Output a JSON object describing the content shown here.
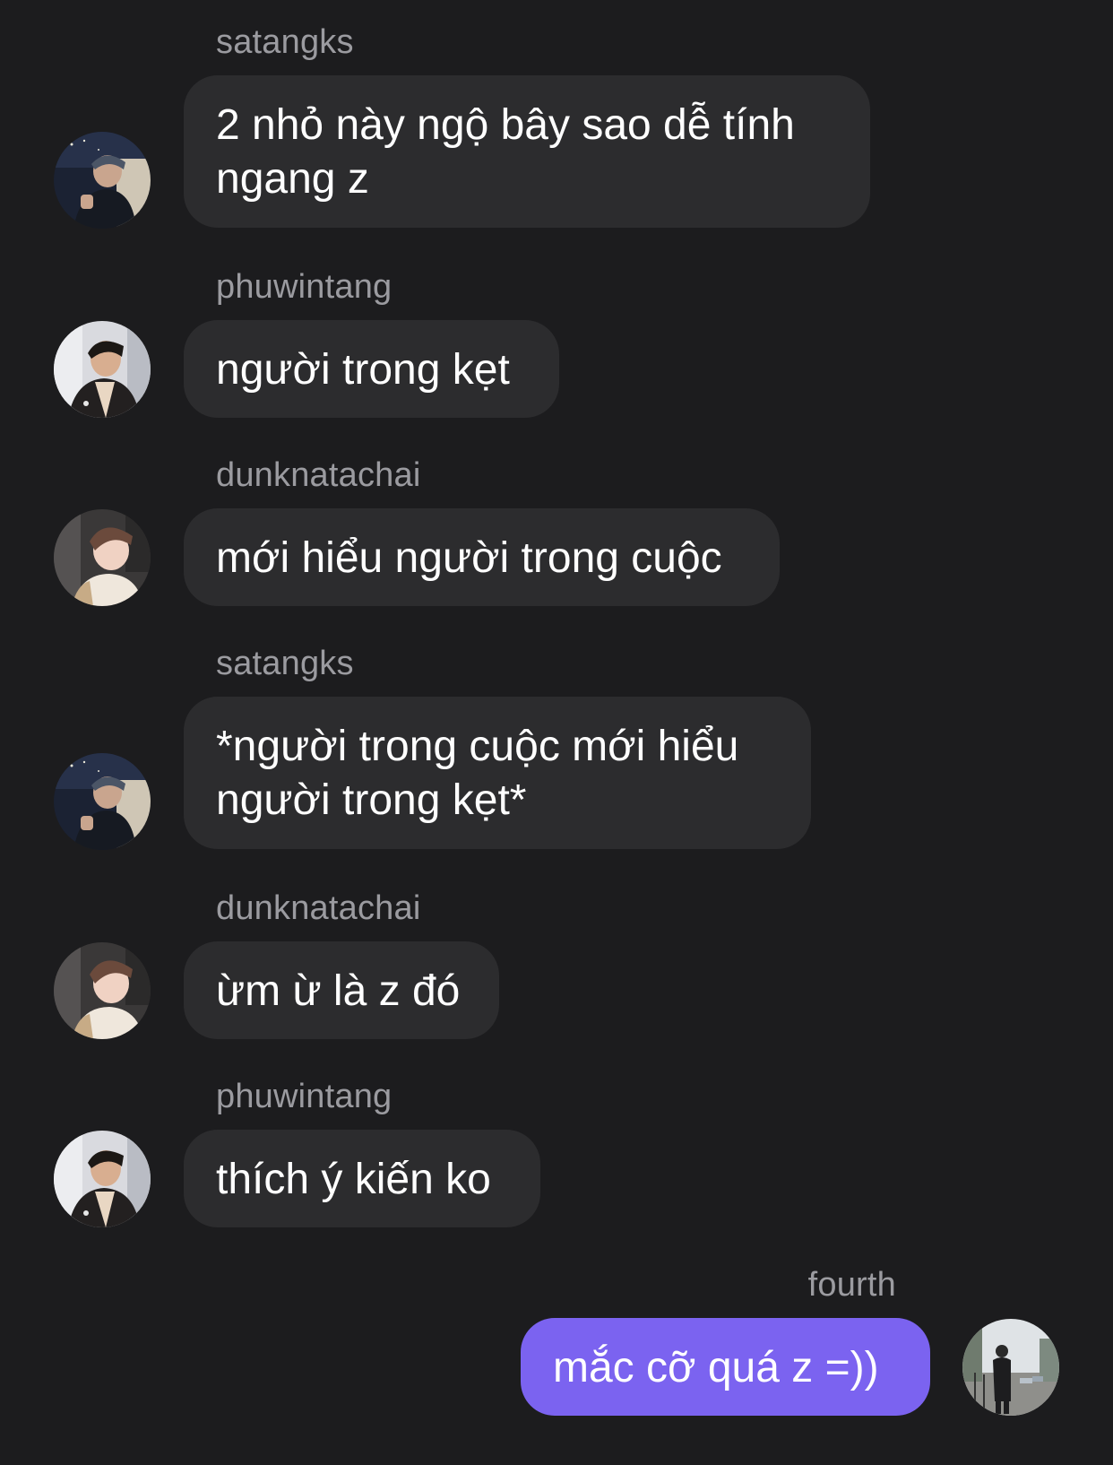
{
  "messages": [
    {
      "sender": "satangks",
      "text": "2 nhỏ này ngộ bây sao dễ tính\nngang z",
      "avatar": "avatar-satangks",
      "outgoing": false
    },
    {
      "sender": "phuwintang",
      "text": "người trong kẹt",
      "avatar": "avatar-phuwintang",
      "outgoing": false
    },
    {
      "sender": "dunknatachai",
      "text": "mới hiểu người trong cuộc",
      "avatar": "avatar-dunknatachai",
      "outgoing": false
    },
    {
      "sender": "satangks",
      "text": "*người trong cuộc mới hiểu\nngười trong kẹt*",
      "avatar": "avatar-satangks",
      "outgoing": false
    },
    {
      "sender": "dunknatachai",
      "text": "ừm ừ là z đó",
      "avatar": "avatar-dunknatachai",
      "outgoing": false
    },
    {
      "sender": "phuwintang",
      "text": "thích ý kiến ko",
      "avatar": "avatar-phuwintang",
      "outgoing": false
    },
    {
      "sender": "fourth",
      "text": "mắc cỡ quá z =))",
      "avatar": "avatar-fourth",
      "outgoing": true
    }
  ],
  "colors": {
    "background": "#1c1c1e",
    "incoming_bubble": "#2c2c2e",
    "outgoing_bubble": "#7b63f0",
    "sender_name": "#9b9ba0",
    "message_text": "#ffffff"
  }
}
